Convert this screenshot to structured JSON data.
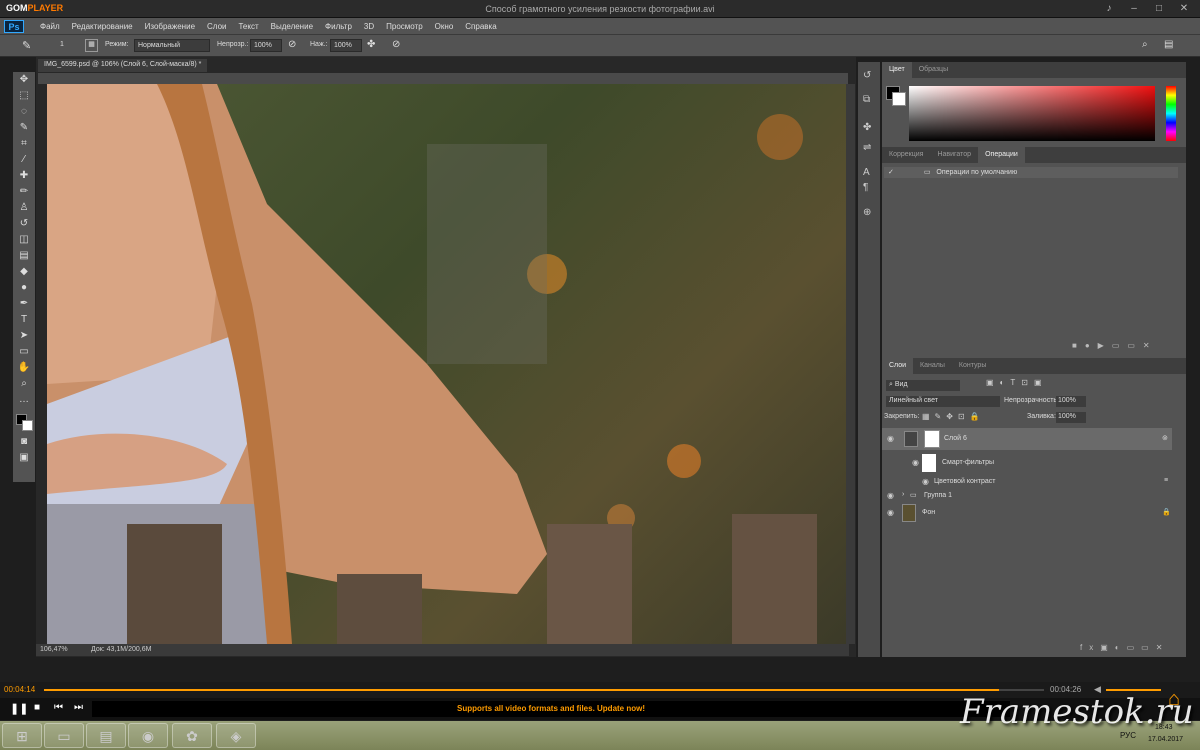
{
  "gom": {
    "logo_a": "GOM",
    "logo_b": "PLAYER",
    "title": "Способ грамотного усиления резкости фотографии.avi",
    "time_current": "00:04:14",
    "time_total": "00:04:26",
    "progress": 0.955,
    "promo": "Supports all video formats and files. Update now!"
  },
  "ps": {
    "logo": "Ps",
    "menu": [
      "Файл",
      "Редактирование",
      "Изображение",
      "Слои",
      "Текст",
      "Выделение",
      "Фильтр",
      "3D",
      "Просмотр",
      "Окно",
      "Справка"
    ],
    "options": {
      "mode_label": "Режим:",
      "mode_value": "Нормальный",
      "opacity_label": "Непрозр.:",
      "opacity_value": "100%",
      "flow_label": "Наж.:",
      "flow_value": "100%",
      "brush_size": "1"
    },
    "doc_tab": "IMG_6599.psd @ 106% (Слой 6, Слой-маска/8) *",
    "zoom": "106,47%",
    "doc_size": "Док: 43,1M/200,6M",
    "panels": {
      "color_tabs": [
        "Цвет",
        "Образцы"
      ],
      "adj_tabs": [
        "Коррекция",
        "Навигатор",
        "Операции"
      ],
      "action_set": "Операции по умолчанию",
      "layers_tabs": [
        "Слои",
        "Каналы",
        "Контуры"
      ],
      "filter_kind": "Вид",
      "blend_mode": "Линейный свет",
      "opacity_label": "Непрозрачность:",
      "opacity_value": "100%",
      "lock_label": "Закрепить:",
      "fill_label": "Заливка:",
      "fill_value": "100%",
      "layers": {
        "l1": "Слой 6",
        "l2": "Смарт-фильтры",
        "l3": "Цветовой контраст",
        "l4": "Группа 1",
        "l5": "Фон"
      }
    }
  },
  "taskbar": {
    "lang": "РУС",
    "time": "18:43",
    "date": "17.04.2017"
  },
  "watermark": "Framestok.ru"
}
